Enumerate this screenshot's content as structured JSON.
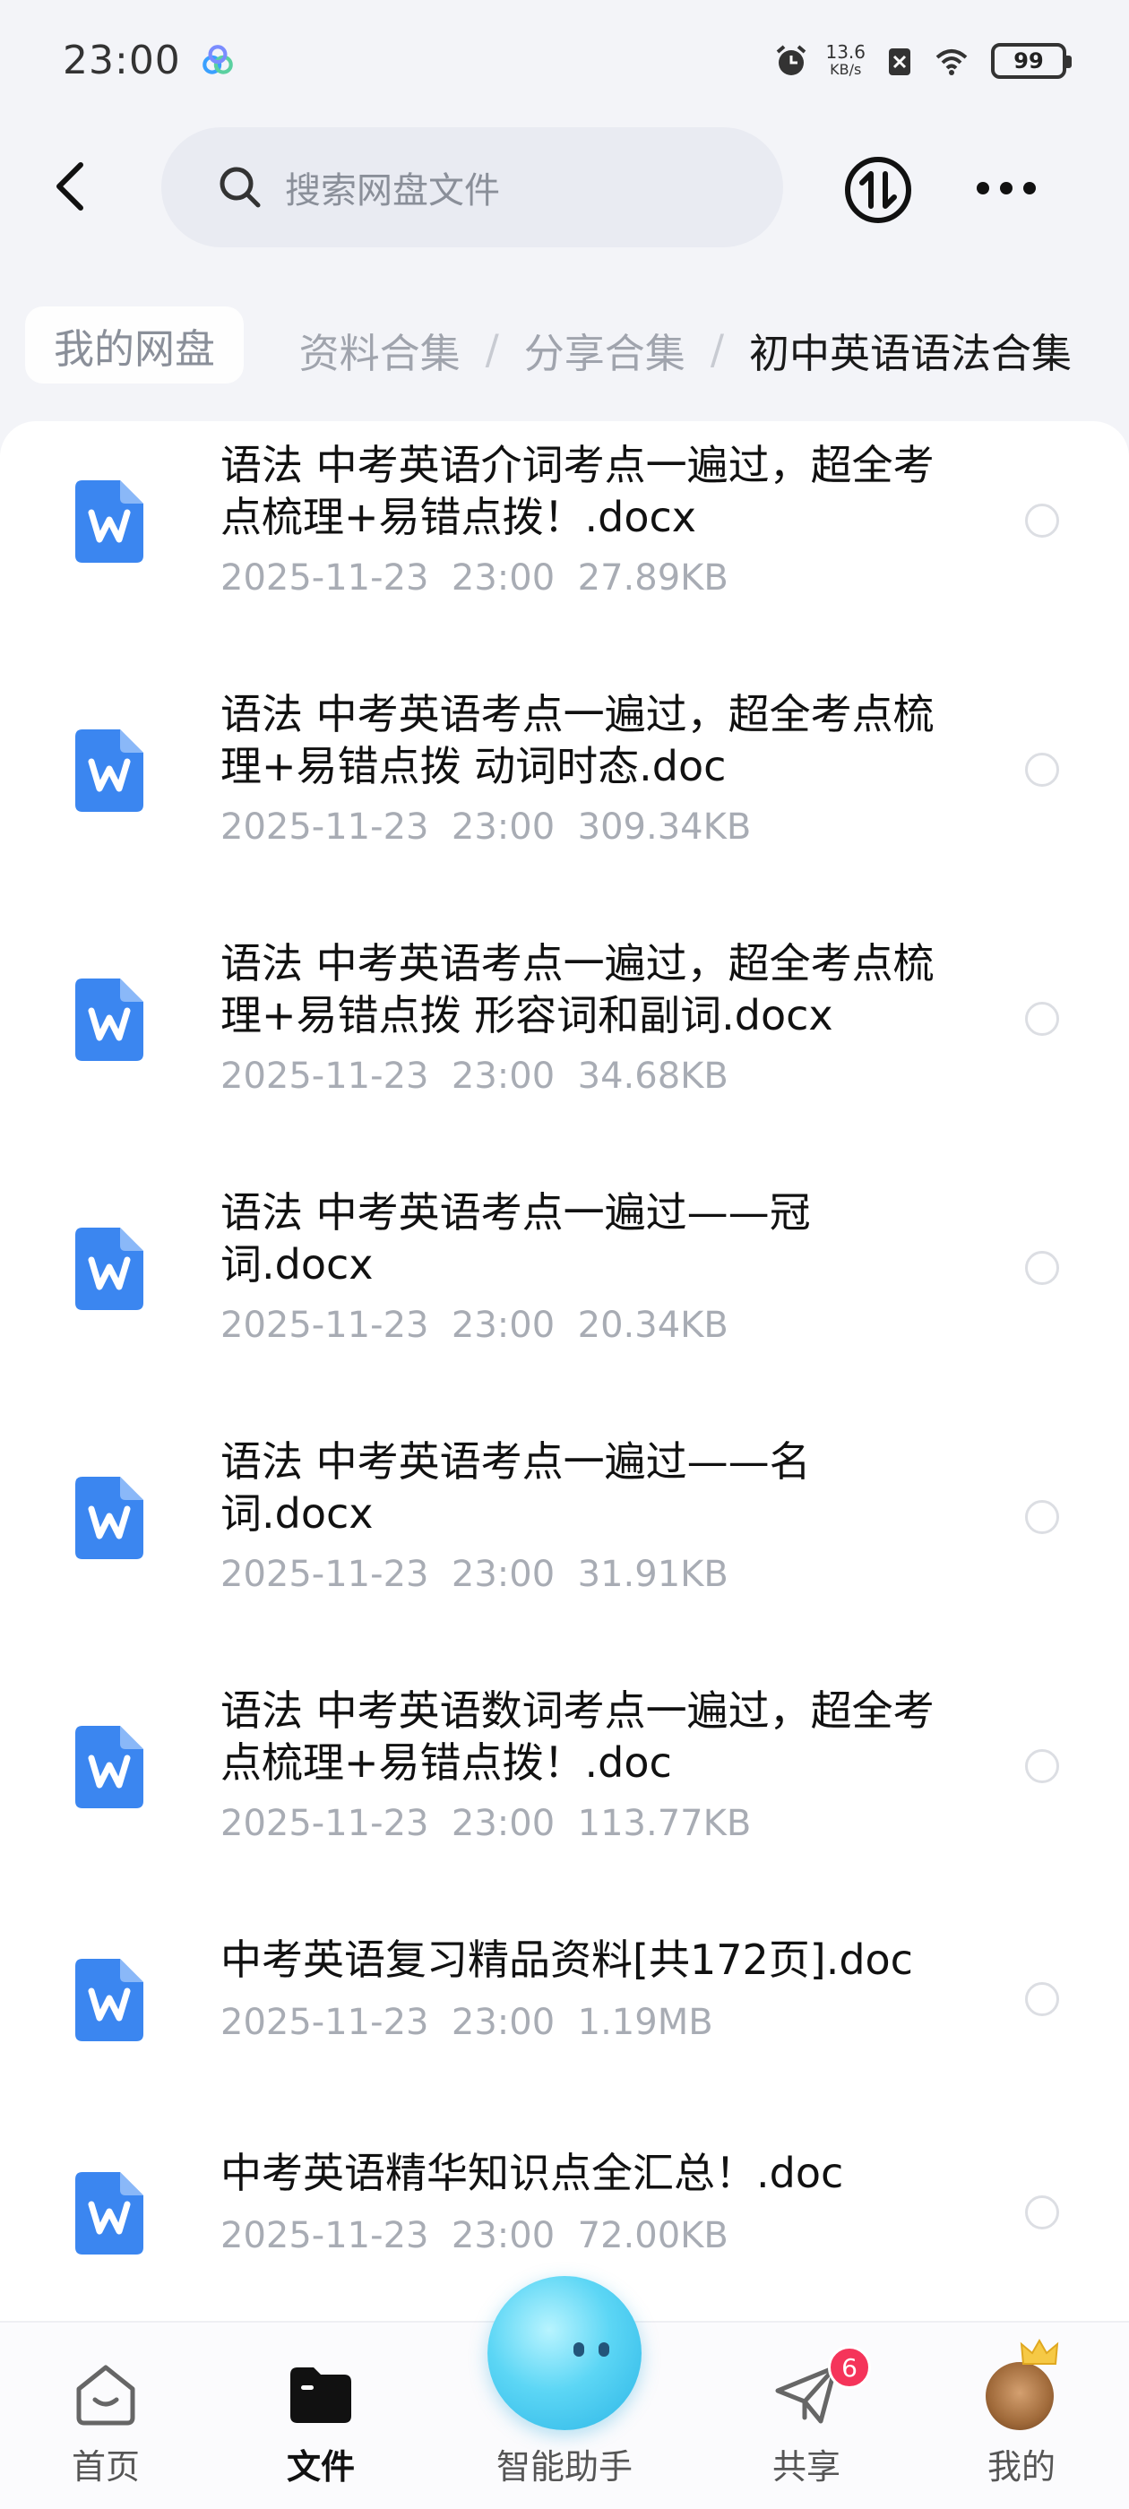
{
  "status_bar": {
    "time": "23:00",
    "net_speed_value": "13.6",
    "net_speed_unit": "KB/s",
    "battery": "99"
  },
  "header": {
    "search_placeholder": "搜索网盘文件"
  },
  "breadcrumb": {
    "root": "我的网盘",
    "items": [
      "资料合集",
      "分享合集",
      "初中英语语法合集"
    ],
    "separator": "/"
  },
  "files": [
    {
      "name": "语法 中考英语介词考点一遍过，超全考点梳理+易错点拨！.docx",
      "date": "2025-11-23",
      "time": "23:00",
      "size": "27.89KB",
      "icon": "word-doc-icon"
    },
    {
      "name": "语法 中考英语考点一遍过，超全考点梳理+易错点拨 动词时态.doc",
      "date": "2025-11-23",
      "time": "23:00",
      "size": "309.34KB",
      "icon": "word-doc-icon"
    },
    {
      "name": "语法 中考英语考点一遍过，超全考点梳理+易错点拨 形容词和副词.docx",
      "date": "2025-11-23",
      "time": "23:00",
      "size": "34.68KB",
      "icon": "word-doc-icon"
    },
    {
      "name": "语法 中考英语考点一遍过——冠词.docx",
      "date": "2025-11-23",
      "time": "23:00",
      "size": "20.34KB",
      "icon": "word-doc-icon"
    },
    {
      "name": "语法 中考英语考点一遍过——名词.docx",
      "date": "2025-11-23",
      "time": "23:00",
      "size": "31.91KB",
      "icon": "word-doc-icon"
    },
    {
      "name": "语法 中考英语数词考点一遍过，超全考点梳理+易错点拨！.doc",
      "date": "2025-11-23",
      "time": "23:00",
      "size": "113.77KB",
      "icon": "word-doc-icon"
    },
    {
      "name": "中考英语复习精品资料[共172页].doc",
      "date": "2025-11-23",
      "time": "23:00",
      "size": "1.19MB",
      "icon": "word-doc-icon"
    },
    {
      "name": "中考英语精华知识点全汇总！.doc",
      "date": "2025-11-23",
      "time": "23:00",
      "size": "72.00KB",
      "icon": "word-doc-icon"
    }
  ],
  "bottom_nav": {
    "home": "首页",
    "files": "文件",
    "assistant": "智能助手",
    "share": "共享",
    "share_badge": "6",
    "me": "我的"
  },
  "colors": {
    "word_icon": "#3b86f0",
    "badge": "#f5345a",
    "background": "#f3f4f8"
  }
}
